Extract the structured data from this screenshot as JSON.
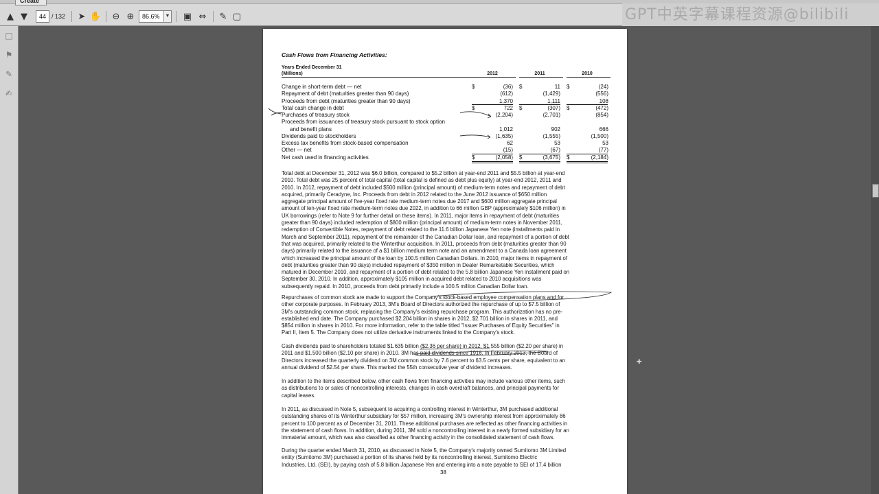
{
  "toolbar": {
    "create_label": "Create",
    "page_current": "44",
    "page_total": "/ 132",
    "zoom": "86.6%",
    "watermark": "GPT中英字幕课程资源@bilibili"
  },
  "document": {
    "section_title": "Cash Flows from Financing Activities:",
    "header_line1": "Years Ended December 31",
    "header_line2": "(Millions)",
    "years": [
      "2012",
      "2011",
      "2010"
    ],
    "rows": [
      {
        "label": "Change in short-term debt — net",
        "d1": "$",
        "v1": "(36)",
        "d2": "$",
        "v2": "11",
        "d3": "$",
        "v3": "(24)"
      },
      {
        "label": "Repayment of debt (maturities greater than 90 days)",
        "v1": "(612)",
        "v2": "(1,429)",
        "v3": "(556)"
      },
      {
        "label": "Proceeds from debt (maturities greater than 90 days)",
        "v1": "1,370",
        "v2": "1,111",
        "v3": "108"
      },
      {
        "label": "Total cash change in debt",
        "d1": "$",
        "v1": "722",
        "d2": "$",
        "v2": "(307)",
        "d3": "$",
        "v3": "(472)"
      },
      {
        "label": "Purchases of treasury stock",
        "v1": "(2,204)",
        "v2": "(2,701)",
        "v3": "(854)"
      },
      {
        "label": "Proceeds from issuances of treasury stock pursuant to stock option",
        "v1": "",
        "v2": "",
        "v3": ""
      },
      {
        "label": "and benefit plans",
        "v1": "1,012",
        "v2": "902",
        "v3": "666"
      },
      {
        "label": "Dividends paid to stockholders",
        "v1": "(1,635)",
        "v2": "(1,555)",
        "v3": "(1,500)"
      },
      {
        "label": "Excess tax benefits from stock-based compensation",
        "v1": "62",
        "v2": "53",
        "v3": "53"
      },
      {
        "label": "Other — net",
        "v1": "(15)",
        "v2": "(67)",
        "v3": "(77)"
      },
      {
        "label": "Net cash used in financing activities",
        "d1": "$",
        "v1": "(2,058)",
        "d2": "$",
        "v2": "(3,675)",
        "d3": "$",
        "v3": "(2,184)"
      }
    ],
    "paragraphs": [
      [
        "Total debt at December 31, 2012 was $6.0 billion, compared to $5.2 billion at year-end 2011 and $5.5 billion at year-end",
        "2010. Total debt was 25 percent of total capital (total capital is defined as debt plus equity) at year-end 2012, 2011 and",
        "2010. In 2012, repayment of debt included $500 million (principal amount) of medium-term notes and repayment of debt",
        "acquired, primarily Ceradyne, Inc. Proceeds from debt in 2012 related to the June 2012 issuance of $650 million",
        "aggregate principal amount of five-year fixed rate medium-term notes due 2017 and $600 million aggregate principal",
        "amount of ten-year fixed rate medium-term notes due 2022, in addition to 66 million GBP (approximately $106 million) in",
        "UK borrowings (refer to Note 9 for further detail on these items). In 2011, major items in repayment of debt (maturities",
        "greater than 90 days) included redemption of $800 million (principal amount) of medium-term notes in November 2011,",
        "redemption of Convertible Notes, repayment of debt related to the 11.6 billion Japanese Yen note (installments paid in",
        "March and September 2011), repayment of the remainder of the Canadian Dollar loan, and repayment of a portion of debt",
        "that was acquired, primarily related to the Winterthur acquisition. In 2011, proceeds from debt (maturities greater than 90",
        "days) primarily related to the issuance of a $1 billion medium term note and an amendment to a Canada loan agreement",
        "which increased the principal amount of the loan by 100.5 million Canadian Dollars. In 2010, major items in repayment of",
        "debt (maturities greater than 90 days) included repayment of $350 million in Dealer Remarketable Securities, which",
        "matured in December 2010, and repayment of a portion of debt related to the 5.8 billion Japanese Yen installment paid on",
        "September 30, 2010. In addition, approximately $105 million in acquired debt related to 2010 acquisitions was",
        "subsequently repaid. In 2010, proceeds from debt primarily include a 100.5 million Canadian Dollar loan."
      ],
      [
        "Repurchases of common stock are made to support the Company's stock-based employee compensation plans and for",
        "other corporate purposes. In February 2013, 3M's Board of Directors authorized the repurchase of up to $7.5 billion of",
        "3M's outstanding common stock, replacing the Company's existing repurchase program. This authorization has no pre-",
        "established end date. The Company purchased $2.204 billion in shares in 2012, $2.701 billion in shares in 2011, and",
        "$854 million in shares in 2010. For more information, refer to the table titled \"Issuer Purchases of Equity Securities\" in",
        "Part II, Item 5. The Company does not utilize derivative instruments linked to the Company's stock."
      ],
      [
        "Cash dividends paid to shareholders totaled $1.635 billion ($2.36 per share) in 2012, $1.555 billion ($2.20 per share) in",
        "2011 and $1.500 billion ($2.10 per share) in 2010. 3M has paid dividends since 1916. In February 2013, the Board of",
        "Directors increased the quarterly dividend on 3M common stock by 7.6 percent to 63.5 cents per share, equivalent to an",
        "annual dividend of $2.54 per share. This marked the 55th consecutive year of dividend increases."
      ],
      [
        "In addition to the items described below, other cash flows from financing activities may include various other items, such",
        "as distributions to or sales of noncontrolling interests, changes in cash overdraft balances, and principal payments for",
        "capital leases."
      ],
      [
        "In 2011, as discussed in Note 5, subsequent to acquiring a controlling interest in Winterthur, 3M purchased additional",
        "outstanding shares of its Winterthur subsidiary for $57 million, increasing 3M's ownership interest from approximately 86",
        "percent to 100 percent as of December 31, 2011. These additional purchases are reflected as other financing activities in",
        "the statement of cash flows. In addition, during 2011, 3M sold a noncontrolling interest in a newly formed subsidiary for an",
        "immaterial amount, which was also classified as other financing activity in the consolidated statement of cash flows."
      ],
      [
        "During the quarter ended March 31, 2010, as discussed in Note 5, the Company's majority owned Sumitomo 3M Limited",
        "entity (Sumitomo 3M) purchased a portion of its shares held by its noncontrolling interest, Sumitomo Electric",
        "Industries, Ltd. (SEI), by paying cash of 5.8 billion Japanese Yen and entering into a note payable to SEI of 17.4 billion"
      ]
    ],
    "page_number": "38"
  }
}
